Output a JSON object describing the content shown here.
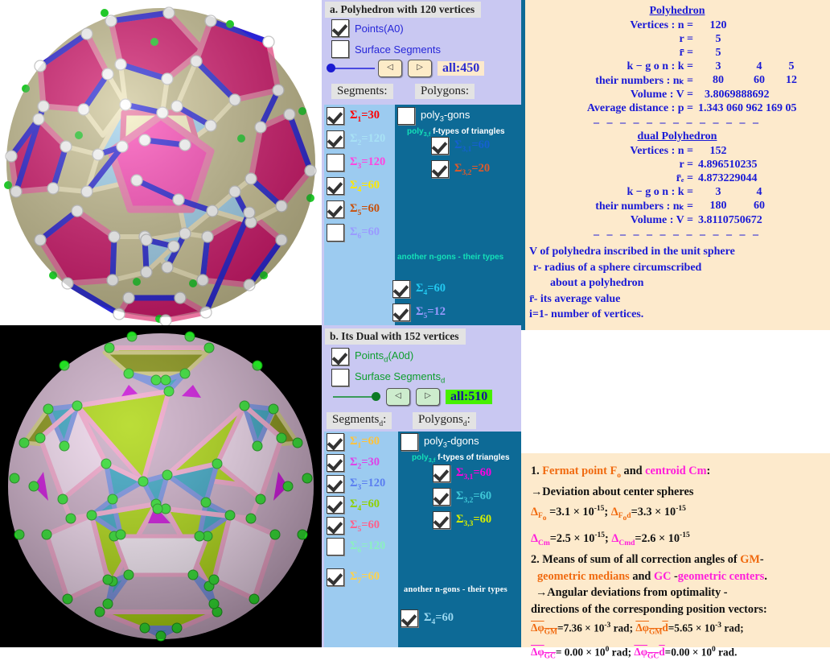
{
  "top": {
    "title": "a. Polyhedron with 120 vertices",
    "points_label": "Points(A0)",
    "surface_label": "Surface Segments",
    "all_value": "all:450",
    "segments_caption": "Segments:",
    "polygons_caption": "Polygons:",
    "polygons_title": "poly",
    "polygons_title_sub": "3",
    "polygons_title_tail": "-gons",
    "ftypes_label": "poly",
    "ftypes_label_sub": "3,f",
    "ftypes_label_tail": "f-types of triangles",
    "another_label": "another n-gons -  their types",
    "segments": [
      {
        "idx": "1",
        "value": "=30",
        "checked": true,
        "color": "#ff0000"
      },
      {
        "idx": "2",
        "value": "=120",
        "checked": true,
        "color": "#a8e2f5"
      },
      {
        "idx": "3",
        "value": "=120",
        "checked": false,
        "color": "#ff44e0"
      },
      {
        "idx": "4",
        "value": "=60",
        "checked": true,
        "color": "#ffe800"
      },
      {
        "idx": "5",
        "value": "=60",
        "checked": true,
        "color": "#c8500a"
      },
      {
        "idx": "6",
        "value": "=60",
        "checked": false,
        "color": "#9a9aff"
      }
    ],
    "ftypes": [
      {
        "idx": "3,1",
        "value": "=60",
        "checked": true,
        "color": "#1560d0"
      },
      {
        "idx": "3,2",
        "value": "=20",
        "checked": true,
        "color": "#e05a2a"
      }
    ],
    "ngons": [
      {
        "idx": "4",
        "value": "=60",
        "checked": true,
        "color": "#22c8f0"
      },
      {
        "idx": "5",
        "value": "=12",
        "checked": true,
        "color": "#9a9aff"
      }
    ]
  },
  "bottom": {
    "title": "b. Its Dual with 152  vertices",
    "points_label": "Points",
    "points_label_sub": "d",
    "points_label_tail": "(A0d)",
    "surface_label": "Surfase Segments",
    "surface_label_sub": "d",
    "all_value": "all:510",
    "segments_caption": "Segments",
    "segments_caption_sub": "d",
    "segments_caption_tail": ":",
    "polygons_caption": "Polygons",
    "polygons_caption_sub": "d",
    "polygons_caption_tail": ":",
    "polygons_title": "poly",
    "polygons_title_sub": "3",
    "polygons_title_tail": "-dgons",
    "ftypes_label": "poly",
    "ftypes_label_sub": "3,f",
    "ftypes_label_tail": "f-types of triangles",
    "another_label": "another n-gons -  their types",
    "segments": [
      {
        "idx": "1",
        "value": "=60",
        "checked": true,
        "color": "#ffc23a"
      },
      {
        "idx": "2",
        "value": "=30",
        "checked": true,
        "color": "#e040e8"
      },
      {
        "idx": "3",
        "value": "=120",
        "checked": true,
        "color": "#5a7ef0"
      },
      {
        "idx": "4",
        "value": "=60",
        "checked": true,
        "color": "#8fd000"
      },
      {
        "idx": "5",
        "value": "=60",
        "checked": true,
        "color": "#ff608a"
      },
      {
        "idx": "6",
        "value": "=120",
        "checked": false,
        "color": "#8cf0c0"
      },
      {
        "idx": "7",
        "value": "=60",
        "checked": true,
        "color": "#ffd24a"
      }
    ],
    "ftypes": [
      {
        "idx": "3,1",
        "value": "=60",
        "checked": true,
        "color": "#ff00e0"
      },
      {
        "idx": "3,2",
        "value": "=60",
        "checked": true,
        "color": "#3fc8d8"
      },
      {
        "idx": "3,3",
        "value": "=60",
        "checked": true,
        "color": "#d8f000"
      }
    ],
    "ngons": [
      {
        "idx": "4",
        "value": "=60",
        "checked": true,
        "color": "#9ad8f0"
      }
    ]
  },
  "polyhedron_info": {
    "title": "Polyhedron",
    "rows": [
      {
        "key": "Vertices : n =",
        "values": [
          "120"
        ]
      },
      {
        "key": "r =",
        "values": [
          "5"
        ]
      },
      {
        "key": "r̄ =",
        "values": [
          "5"
        ]
      },
      {
        "key": "k − g o n : k =",
        "values": [
          "3",
          "4",
          "5"
        ]
      },
      {
        "key": "their numbers : nₖ =",
        "values": [
          "80",
          "60",
          "12"
        ]
      },
      {
        "key": "Volume : V =",
        "values": [
          "3.8069888692"
        ]
      },
      {
        "key": "Average distance : p =",
        "values": [
          "1.343 060 962 169 05"
        ]
      }
    ],
    "dual_title": "dual Polyhedron",
    "dual_rows": [
      {
        "key": "Vertices : n =",
        "values": [
          "152"
        ]
      },
      {
        "key": "r =",
        "values": [
          "4.896510235"
        ]
      },
      {
        "key": "r̄ₑ =",
        "values": [
          "4.873229044"
        ]
      },
      {
        "key": "k − g o n : k =",
        "values": [
          "3",
          "4"
        ]
      },
      {
        "key": "their numbers : nₖ =",
        "values": [
          "180",
          "60"
        ]
      },
      {
        "key": "Volume : V =",
        "values": [
          "3.8110750672"
        ]
      }
    ],
    "legend": [
      "V of polyhedra inscribed in the unit sphere",
      "r-  radius of a sphere circumscribed",
      "about a polyhedron",
      "r̄-  its average value",
      "i=1-  number of  vertices."
    ]
  },
  "deviations": {
    "line1_a": "1. ",
    "line1_fermat": "Fermat point  F",
    "line1_fermat_sub": "o",
    "line1_and": " and  ",
    "line1_centroid": "centroid Cm",
    "line1_colon": ":",
    "line2": "→Deviation about center spheres",
    "l3_sym1": "Δ",
    "l3_sub1": "F",
    "l3_sub1b": "o",
    "l3_val1": " =3.1 × 10",
    "l3_exp1": "-15",
    "l3_sep": "; ",
    "l3_sym2": "Δ",
    "l3_sub2": "F",
    "l3_sub2b": "o",
    "l3_sub2c": "d",
    "l3_val2": "=3.3 × 10",
    "l3_exp2": "-15",
    "l4_sym1": "Δ",
    "l4_sub1": "Cm",
    "l4_val1": "=2.5 × 10",
    "l4_exp1": "-15",
    "l4_sep": "; ",
    "l4_sym2": "Δ",
    "l4_sub2": "Cmd",
    "l4_val2": "=2.6 × 10",
    "l4_exp2": "-15",
    "line5_a": "2. Means of sum of all correction angles of ",
    "line5_gm": "GM",
    "line5_b": "-",
    "line6_a": "geometric medians",
    "line6_b": " and ",
    "line6_gc": "GC",
    "line6_c": " -",
    "line6_d": "geometric centers",
    "line6_e": ".",
    "line7": "→Angular deviations from optimality -",
    "line8": "directions of the corresponding position vectors:",
    "l9_sym1": "Δφ",
    "l9_sub1": "GM",
    "l9_val1": "=7.36 × 10",
    "l9_exp1": "-3",
    "l9_unit1": " rad; ",
    "l9_sym2": "Δφ",
    "l9_sub2": "GM",
    "l9_tail2": "d",
    "l9_val2": "=5.65 × 10",
    "l9_exp2": "-3",
    "l9_unit2": " rad;",
    "l10_sym1": "Δφ",
    "l10_sub1": "GC",
    "l10_val1": "= 0.00 × 10",
    "l10_exp1": "0",
    "l10_unit1": " rad;  ",
    "l10_sym2": "Δφ",
    "l10_sub2": "GC",
    "l10_tail2": "d",
    "l10_val2": "=0.00 × 10",
    "l10_exp2": "0",
    "l10_unit2": " rad."
  },
  "colors": {
    "lavender": "#c9c8f2",
    "light_blue": "#9ccbf0",
    "teal": "#0d6a96",
    "cream": "#fdeacc",
    "info_blue": "#1a1ad6",
    "accent_green": "#46f000"
  },
  "figures": {
    "top": {
      "name": "snub-polyhedron-120-vertices",
      "background": "#ffffff",
      "face_colors": [
        "#d8146e",
        "#ff48b8",
        "#f5f0b8",
        "#9fd2ef",
        "#c3bb8d",
        "#efe6bb"
      ],
      "edge_color": "#1f1fd8",
      "vertex_color": "#ffffff"
    },
    "bottom": {
      "name": "dual-polyhedron-152-vertices",
      "background": "#000000",
      "face_colors": [
        "#a8d400",
        "#c9a9c4",
        "#e8c9e8",
        "#2b9fbf",
        "#f5e0f5",
        "#7d8a00"
      ],
      "edge_color": "#f2a0c8",
      "vertex_color": "#22e022"
    }
  }
}
